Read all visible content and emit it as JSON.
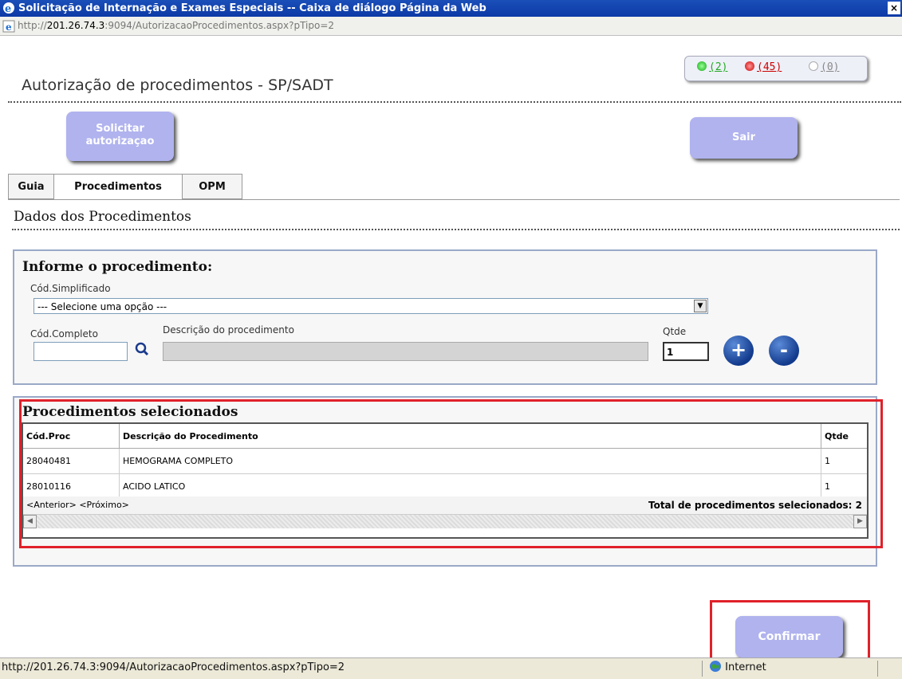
{
  "window": {
    "title": "Solicitação de Internação e Exames Especiais -- Caixa de diálogo Página da Web",
    "close_label": "×",
    "url_prefix": "http://",
    "url_host": "201.26.74.3",
    "url_rest": ":9094/AutorizacaoProcedimentos.aspx?pTipo=2"
  },
  "indicators": [
    {
      "label": "(2)",
      "color": "#22aa22"
    },
    {
      "label": "(45)",
      "color": "#cc0000"
    },
    {
      "label": "(0)",
      "color": "#888888"
    }
  ],
  "page": {
    "title": "Autorização de procedimentos - SP/SADT"
  },
  "buttons": {
    "solicitar_line1": "Solicitar",
    "solicitar_line2": "autorizaçao",
    "sair": "Sair",
    "confirmar": "Confirmar"
  },
  "tabs": [
    "Guia",
    "Procedimentos",
    "OPM"
  ],
  "section_title": "Dados dos Procedimentos",
  "form": {
    "heading": "Informe o procedimento:",
    "cod_simplificado_label": "Cód.Simplificado",
    "select_value": "--- Selecione uma opção ---",
    "cod_completo_label": "Cód.Completo",
    "descricao_label": "Descrição do procedimento",
    "qtde_label": "Qtde",
    "qtde_value": "1",
    "add_label": "+",
    "remove_label": "-"
  },
  "selected": {
    "heading": "Procedimentos selecionados",
    "columns": [
      "Cód.Proc",
      "Descrição do Procedimento",
      "Qtde"
    ],
    "rows": [
      {
        "cod": "28040481",
        "descricao": "HEMOGRAMA COMPLETO",
        "qtde": "1"
      },
      {
        "cod": "28010116",
        "descricao": "ACIDO LATICO",
        "qtde": "1"
      }
    ],
    "pager": "<Anterior> <Próximo>",
    "total": "Total de procedimentos selecionados: 2"
  },
  "statusbar": {
    "url": "http://201.26.74.3:9094/AutorizacaoProcedimentos.aspx?pTipo=2",
    "zone": "Internet"
  }
}
